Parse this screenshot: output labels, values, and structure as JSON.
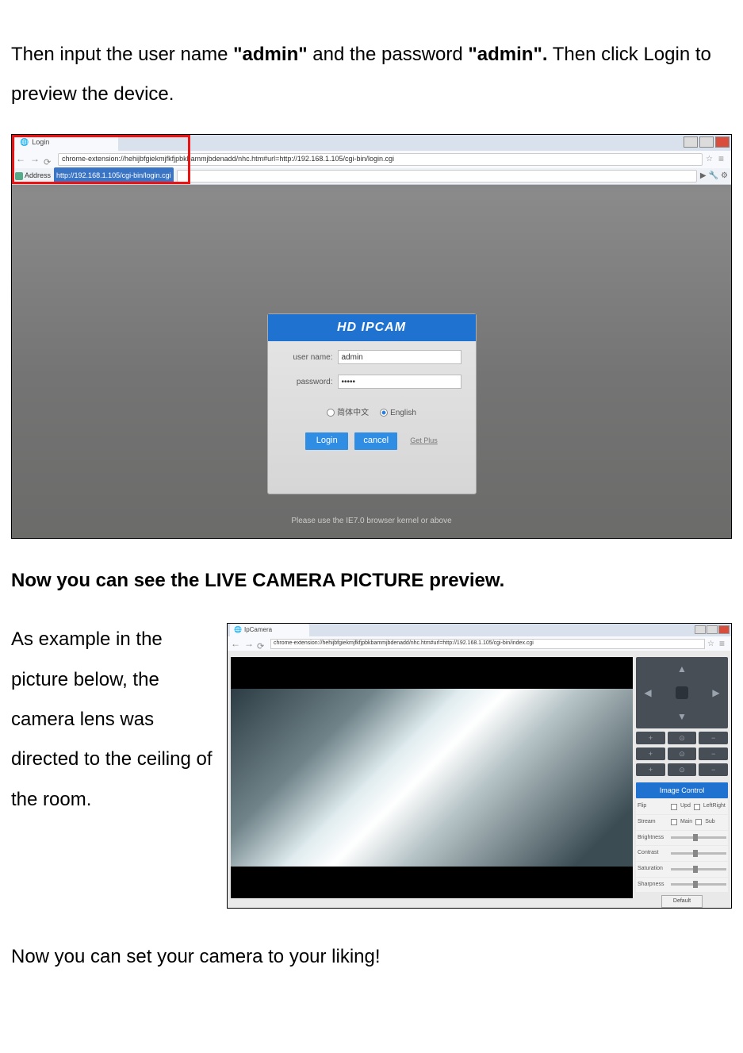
{
  "intro": {
    "part1": "Then input the user name ",
    "bold1": "\"admin\"",
    "part2": " and the password ",
    "bold2": "\"admin\".",
    "part3": " Then click Login to preview the device."
  },
  "shot1": {
    "tab_title": "Login",
    "url": "chrome-extension://hehijbfgiekmjfkfjpbkbammjbdenadd/nhc.htm#url=http://192.168.1.105/cgi-bin/login.cgi",
    "address_label": "Address",
    "address_value": "http://192.168.1.105/cgi-bin/login.cgi",
    "login_title": "HD IPCAM",
    "user_label": "user name:",
    "user_value": "admin",
    "pass_label": "password:",
    "pass_value": "•••••",
    "lang_cn": "简体中文",
    "lang_en": "English",
    "btn_login": "Login",
    "btn_cancel": "cancel",
    "get_plus": "Get Plus",
    "hint": "Please use the IE7.0 browser kernel or above"
  },
  "mid": {
    "heading": "Now you can see the LIVE CAMERA PICTURE preview.",
    "para": "As example in the picture below, the camera lens was directed to the ceiling of the room."
  },
  "shot2": {
    "tab_title": "IpCamera",
    "url": "chrome-extension://hehijbfgiekmjfkfjpbkbammjbdenadd/nhc.htm#url=http://192.168.1.105/cgi-bin/index.cgi",
    "image_control": "Image Control",
    "flip": "Flip",
    "flip_upd": "Upd",
    "flip_lr": "LeftRight",
    "stream": "Stream",
    "stream_main": "Main",
    "stream_sub": "Sub",
    "brightness": "Brightness",
    "contrast": "Contrast",
    "saturation": "Saturation",
    "sharpness": "Sharpness",
    "default_btn": "Default"
  },
  "final": "Now you can set your camera to your liking!"
}
